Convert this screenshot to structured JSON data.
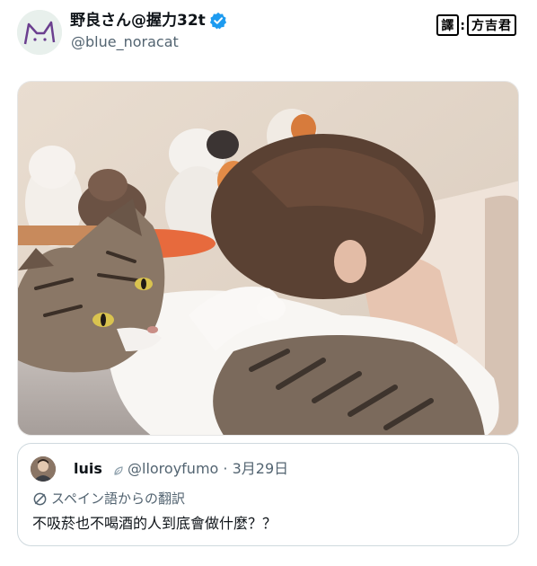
{
  "author": {
    "display_name": "野良さん@握力32t",
    "handle": "@blue_noracat",
    "verified_icon": "verified-badge-icon",
    "avatar_icon": "cat-face-avatar-icon"
  },
  "translator_badge": {
    "label_left": "譯",
    "separator": ":",
    "label_right": "方吉君"
  },
  "photo": {
    "icon": "cat-and-person-photo"
  },
  "quoted_tweet": {
    "name": "luis",
    "handle": "@lloroyfumo",
    "separator": "·",
    "date": "3月29日",
    "translation_note": "スペイン語からの翻訳",
    "text": "不吸菸也不喝酒的人到底會做什麼？？"
  },
  "colors": {
    "verified_blue": "#1d9bf0",
    "secondary_text": "#536471",
    "border": "#cfd9de"
  }
}
